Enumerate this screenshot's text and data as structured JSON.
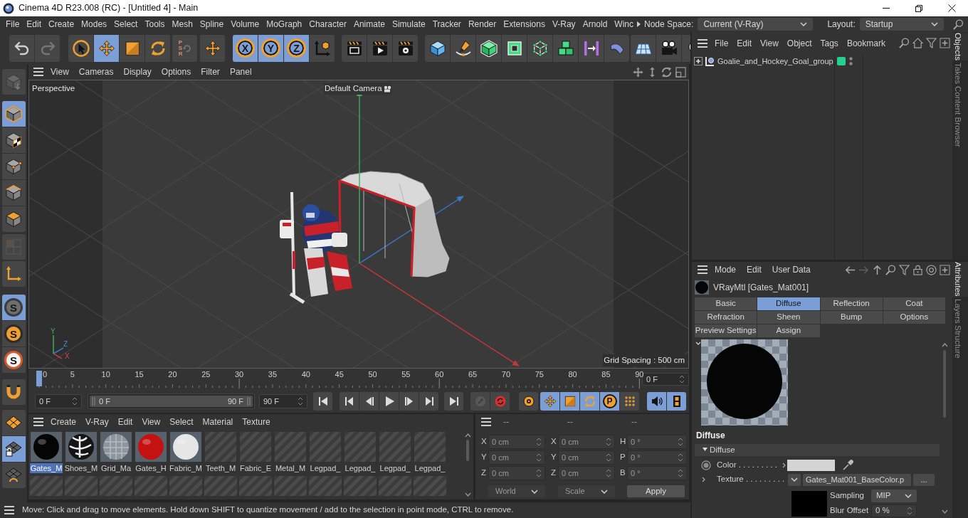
{
  "window": {
    "title": "Cinema 4D R23.008 (RC) - [Untitled 4] - Main"
  },
  "menu_bar": {
    "items": [
      "File",
      "Edit",
      "Create",
      "Modes",
      "Select",
      "Tools",
      "Mesh",
      "Spline",
      "Volume",
      "MoGraph",
      "Character",
      "Animate",
      "Simulate",
      "Tracker",
      "Render",
      "Extensions",
      "V-Ray",
      "Arnold",
      "Winc"
    ],
    "node_space": {
      "label": "Node Space:",
      "value": "Current (V-Ray)"
    },
    "layout": {
      "label": "Layout:",
      "value": "Startup"
    }
  },
  "main_toolbar": [
    [
      {
        "selected": false,
        "disabled": false
      },
      {
        "selected": false,
        "disabled": true
      }
    ],
    [
      {
        "selected": false,
        "disabled": false
      },
      {
        "selected": true,
        "disabled": false
      },
      {
        "selected": false,
        "disabled": false
      },
      {
        "selected": false,
        "disabled": false
      }
    ],
    [
      {
        "selected": false,
        "disabled": true,
        "label": "PSR"
      }
    ],
    [
      {
        "selected": false,
        "disabled": false
      }
    ],
    [
      {
        "selected": true,
        "disabled": false,
        "label": "X"
      },
      {
        "selected": true,
        "disabled": false,
        "label": "Y"
      },
      {
        "selected": true,
        "disabled": false,
        "label": "Z"
      },
      {
        "selected": false,
        "disabled": false
      }
    ],
    [
      {
        "selected": false,
        "disabled": false
      },
      {
        "selected": false,
        "disabled": false
      },
      {
        "selected": false,
        "disabled": false
      }
    ],
    [
      {
        "selected": false,
        "disabled": false
      },
      {
        "selected": false,
        "disabled": false
      },
      {
        "selected": false,
        "disabled": false
      },
      {
        "selected": false,
        "disabled": false
      },
      {
        "selected": false,
        "disabled": false
      },
      {
        "selected": false,
        "disabled": false
      },
      {
        "selected": false,
        "disabled": false
      },
      {
        "selected": false,
        "disabled": false
      }
    ],
    [
      {
        "selected": false,
        "disabled": false
      },
      {
        "selected": false,
        "disabled": false
      },
      {
        "selected": false,
        "disabled": false
      }
    ]
  ],
  "left_toolbar": [
    [
      {
        "selected": false,
        "disabled": true
      }
    ],
    [
      {
        "selected": true,
        "disabled": false
      },
      {
        "selected": false,
        "disabled": false
      },
      {
        "selected": false,
        "disabled": false
      },
      {
        "selected": false,
        "disabled": false
      },
      {
        "selected": false,
        "disabled": false
      }
    ],
    [
      {
        "selected": false,
        "disabled": true
      }
    ],
    [
      {
        "selected": false,
        "disabled": false
      }
    ],
    [
      {
        "selected": true,
        "disabled": false,
        "label": "S"
      },
      {
        "selected": false,
        "disabled": false,
        "label": "S"
      },
      {
        "selected": false,
        "disabled": false,
        "label": "S"
      }
    ],
    [
      {
        "selected": false,
        "disabled": false
      }
    ],
    [
      {
        "selected": false,
        "disabled": false
      },
      {
        "selected": true,
        "disabled": false
      },
      {
        "selected": false,
        "disabled": false
      }
    ]
  ],
  "viewport": {
    "menu": [
      "View",
      "Cameras",
      "Display",
      "Options",
      "Filter",
      "Panel"
    ],
    "view_name": "Perspective",
    "camera": "Default Camera",
    "grid_spacing": "Grid Spacing : 500 cm",
    "gizmo_labels": [
      "Y",
      "Z",
      "X"
    ]
  },
  "timeline": {
    "frames": [
      "0",
      "5",
      "10",
      "15",
      "20",
      "25",
      "30",
      "35",
      "40",
      "45",
      "50",
      "55",
      "60",
      "65",
      "70",
      "75",
      "80",
      "85",
      "90"
    ],
    "playhead": {
      "level": 0
    },
    "current_frame": "0 F"
  },
  "playback": {
    "start": "0 F",
    "range": {
      "start": "0 F",
      "end": "90 F",
      "level": 1
    },
    "end": "90 F",
    "buttons": [
      [
        {
          "selected": false,
          "disabled": false
        }
      ],
      [
        {
          "selected": false,
          "disabled": false
        },
        {
          "selected": false,
          "disabled": false
        },
        {
          "selected": false,
          "disabled": false
        },
        {
          "selected": false,
          "disabled": false
        },
        {
          "selected": false,
          "disabled": false
        }
      ],
      [
        {
          "selected": false,
          "disabled": false
        }
      ],
      [
        {
          "selected": false,
          "disabled": true
        },
        {
          "selected": false,
          "disabled": false
        }
      ],
      [
        {
          "selected": false,
          "disabled": false
        }
      ],
      [
        {
          "selected": true,
          "disabled": false
        },
        {
          "selected": true,
          "disabled": false
        },
        {
          "selected": true,
          "disabled": false
        },
        {
          "selected": true,
          "disabled": false,
          "label": "P"
        },
        {
          "selected": false,
          "disabled": false
        }
      ],
      [
        {
          "selected": true,
          "disabled": false
        },
        {
          "selected": true,
          "disabled": false
        }
      ]
    ]
  },
  "materials": {
    "menu": [
      "Create",
      "V-Ray",
      "Edit",
      "View",
      "Select",
      "Material",
      "Texture"
    ],
    "items": [
      {
        "name": "Gates_M",
        "selected": true,
        "kind": "sphere",
        "color": "#050505"
      },
      {
        "name": "Shoes_M",
        "selected": false,
        "kind": "pattern",
        "color": "#151515"
      },
      {
        "name": "Grid_Ma",
        "selected": false,
        "kind": "checker",
        "color": "#8e959c"
      },
      {
        "name": "Gates_H",
        "selected": false,
        "kind": "sphere",
        "color": "#c41212"
      },
      {
        "name": "Fabric_M",
        "selected": false,
        "kind": "sphere",
        "color": "#e6e6e6"
      },
      {
        "name": "Teeth_M",
        "selected": false,
        "kind": "none"
      },
      {
        "name": "Fabric_E",
        "selected": false,
        "kind": "none"
      },
      {
        "name": "Metal_M",
        "selected": false,
        "kind": "none"
      },
      {
        "name": "Legpad_",
        "selected": false,
        "kind": "none"
      },
      {
        "name": "Legpad_",
        "selected": false,
        "kind": "none"
      },
      {
        "name": "Legpad_",
        "selected": false,
        "kind": "none"
      },
      {
        "name": "Legpad_",
        "selected": false,
        "kind": "none"
      }
    ]
  },
  "coordinates": {
    "disabled": true,
    "headers": [
      "--",
      "--",
      "--"
    ],
    "rows": [
      {
        "fields": [
          {
            "axis": "X",
            "value": "0 cm"
          },
          {
            "axis": "X",
            "value": "0 cm"
          },
          {
            "axis": "H",
            "value": "0 °"
          }
        ]
      },
      {
        "fields": [
          {
            "axis": "Y",
            "value": "0 cm"
          },
          {
            "axis": "Y",
            "value": "0 cm"
          },
          {
            "axis": "P",
            "value": "0 °"
          }
        ]
      },
      {
        "fields": [
          {
            "axis": "Z",
            "value": "0 cm"
          },
          {
            "axis": "Z",
            "value": "0 cm"
          },
          {
            "axis": "B",
            "value": "0 °"
          }
        ]
      }
    ],
    "dropdowns": [
      "World",
      "Scale"
    ],
    "apply": "Apply"
  },
  "status_bar": {
    "text": "Move: Click and drag to move elements. Hold down SHIFT to quantize movement / add to the selection in point mode, CTRL to remove."
  },
  "object_manager": {
    "menu": [
      "File",
      "Edit",
      "View",
      "Object",
      "Tags",
      "Bookmark"
    ],
    "objects": [
      {
        "name": "Goalie_and_Hockey_Goal_group",
        "expanded": false
      }
    ]
  },
  "side_tabs": {
    "top": [
      {
        "label": "Objects",
        "selected": true
      },
      {
        "label": "Takes",
        "selected": false
      },
      {
        "label": "Content Browser",
        "selected": false
      }
    ],
    "bottom": [
      {
        "label": "Attributes",
        "selected": true
      },
      {
        "label": "Layers",
        "selected": false
      },
      {
        "label": "Structure",
        "selected": false
      }
    ]
  },
  "attributes": {
    "menu": [
      "Mode",
      "Edit",
      "User Data"
    ],
    "title": "VRayMtl [Gates_Mat001]",
    "tabs": [
      {
        "label": "Basic",
        "selected": false
      },
      {
        "label": "Diffuse",
        "selected": true
      },
      {
        "label": "Reflection",
        "selected": false
      },
      {
        "label": "Coat",
        "selected": false
      },
      {
        "label": "Refraction",
        "selected": false
      },
      {
        "label": "Sheen",
        "selected": false
      },
      {
        "label": "Bump",
        "selected": false
      },
      {
        "label": "Options",
        "selected": false
      },
      {
        "label": "Preview Settings",
        "selected": false
      },
      {
        "label": "Assign",
        "selected": false
      }
    ],
    "section": "Diffuse",
    "group": {
      "label": "Diffuse",
      "expanded": true
    },
    "color": {
      "label": "Color . . . . . . . . .",
      "color": "#d4d4d4"
    },
    "texture": {
      "label": "Texture . . . . . . . . .",
      "file": "Gates_Mat001_BaseColor.p",
      "browse": "..."
    },
    "sampling": {
      "label": "Sampling",
      "value": "MIP"
    },
    "blur_offset": {
      "label": "Blur Offset",
      "value": "0 %"
    }
  }
}
